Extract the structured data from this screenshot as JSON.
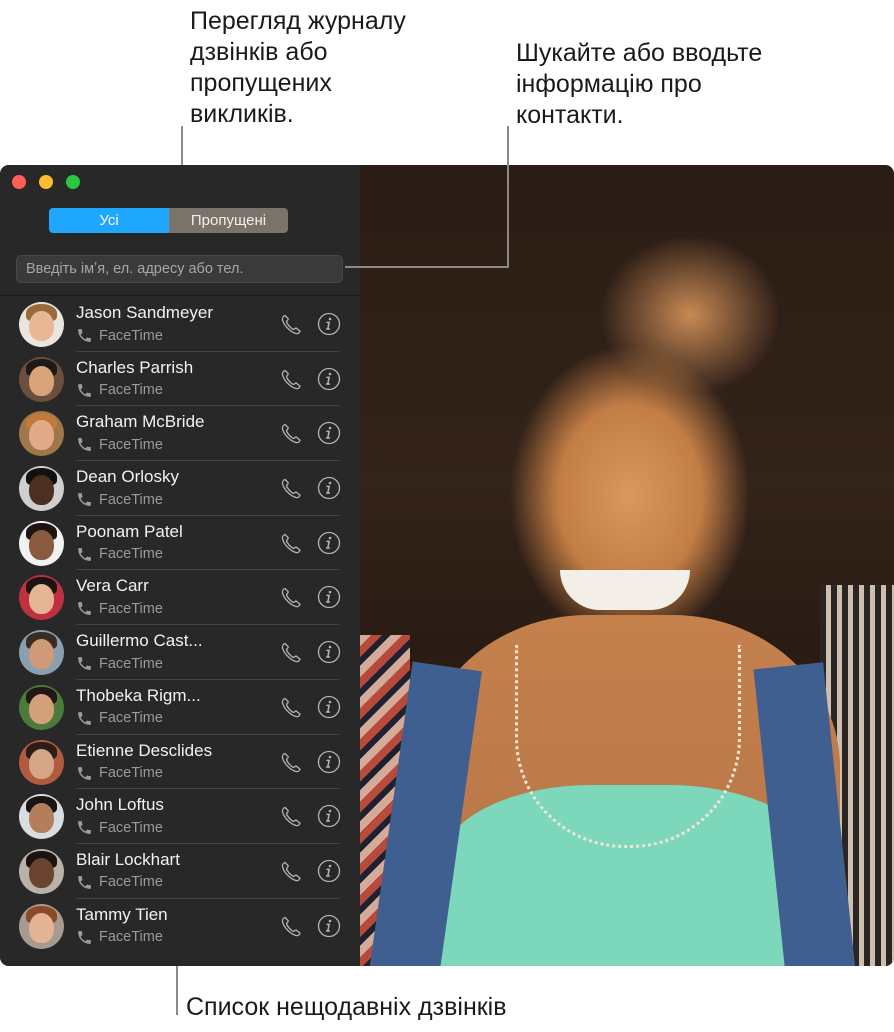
{
  "callouts": {
    "history": [
      "Перегляд журналу",
      "дзвінків або",
      "пропущених",
      "викликів."
    ],
    "search": [
      "Шукайте або вводьте",
      "інформацію про",
      "контакти."
    ],
    "list": "Список нещодавніх дзвінків"
  },
  "window": {
    "controls": [
      "close",
      "minimize",
      "zoom"
    ],
    "segments": {
      "all": "Усі",
      "missed": "Пропущені",
      "selected": "all"
    },
    "accent_color": "#1ea7fd",
    "search": {
      "placeholder": "Введіть імʼя, ел. адресу або тел.",
      "value": ""
    }
  },
  "calls": [
    {
      "name": "Jason Sandmeyer",
      "type": "FaceTime",
      "avatar_icon": "contact-photo"
    },
    {
      "name": "Charles Parrish",
      "type": "FaceTime",
      "avatar_icon": "contact-photo"
    },
    {
      "name": "Graham McBride",
      "type": "FaceTime",
      "avatar_icon": "contact-photo"
    },
    {
      "name": "Dean Orlosky",
      "type": "FaceTime",
      "avatar_icon": "contact-photo"
    },
    {
      "name": "Poonam Patel",
      "type": "FaceTime",
      "avatar_icon": "contact-photo"
    },
    {
      "name": "Vera Carr",
      "type": "FaceTime",
      "avatar_icon": "contact-photo"
    },
    {
      "name": "Guillermo Cast...",
      "type": "FaceTime",
      "avatar_icon": "contact-photo"
    },
    {
      "name": "Thobeka Rigm...",
      "type": "FaceTime",
      "avatar_icon": "contact-photo"
    },
    {
      "name": "Etienne Desclides",
      "type": "FaceTime",
      "avatar_icon": "contact-photo"
    },
    {
      "name": "John Loftus",
      "type": "FaceTime",
      "avatar_icon": "contact-photo"
    },
    {
      "name": "Blair Lockhart",
      "type": "FaceTime",
      "avatar_icon": "contact-photo"
    },
    {
      "name": "Tammy Tien",
      "type": "FaceTime",
      "avatar_icon": "contact-photo"
    }
  ],
  "avatar_palette": [
    {
      "bg": "#e9e6e2",
      "skin": "#e8b896",
      "hair": "#9a6a3a"
    },
    {
      "bg": "#6a4e3e",
      "skin": "#d9a47a",
      "hair": "#1e1a18"
    },
    {
      "bg": "#a0774a",
      "skin": "#e2a98a",
      "hair": "#c07a3a"
    },
    {
      "bg": "#cfcfcf",
      "skin": "#4a2f22",
      "hair": "#151010"
    },
    {
      "bg": "#f2f2f2",
      "skin": "#8a5a3e",
      "hair": "#1b1410"
    },
    {
      "bg": "#c0313f",
      "skin": "#e3b593",
      "hair": "#1a1412"
    },
    {
      "bg": "#8aa0b0",
      "skin": "#cf9a78",
      "hair": "#3a2c22"
    },
    {
      "bg": "#4b7a3a",
      "skin": "#d4a07c",
      "hair": "#221815"
    },
    {
      "bg": "#b05a40",
      "skin": "#d6a586",
      "hair": "#2b1e18"
    },
    {
      "bg": "#d8dde2",
      "skin": "#b57e5a",
      "hair": "#1a1412"
    },
    {
      "bg": "#b9b2a8",
      "skin": "#6a4430",
      "hair": "#1b1410"
    },
    {
      "bg": "#a89a90",
      "skin": "#e2b495",
      "hair": "#8a4a2a"
    }
  ],
  "video": {
    "description": "incoming FaceTime video of a smiling woman"
  }
}
